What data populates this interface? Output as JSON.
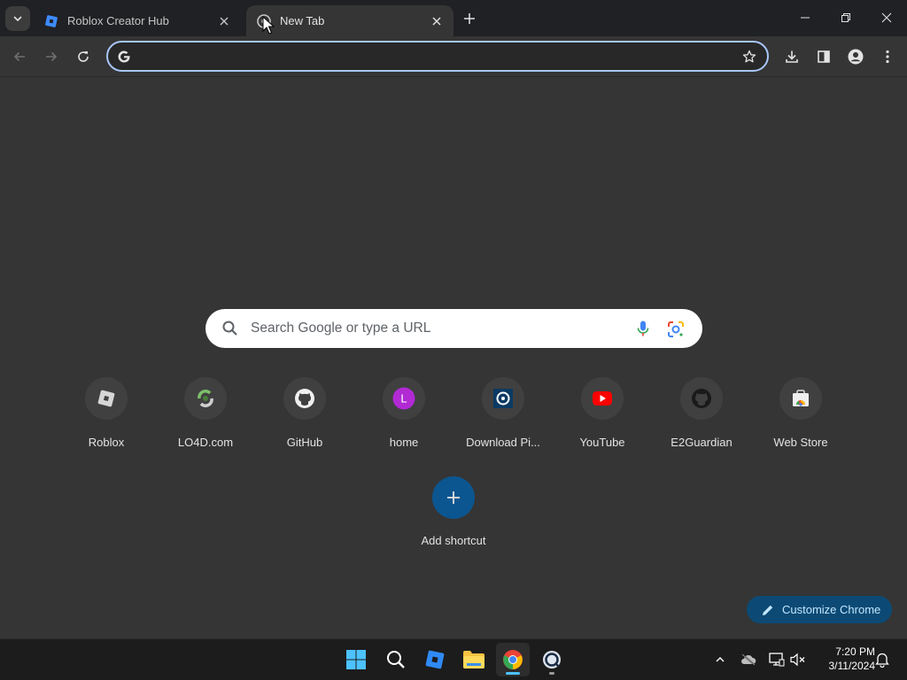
{
  "tabs": [
    {
      "title": "Roblox Creator Hub",
      "favicon": "roblox-studio-icon"
    },
    {
      "title": "New Tab",
      "favicon": "chrome-newtab-icon"
    }
  ],
  "omnibox": {
    "value": "",
    "placeholder": ""
  },
  "ntp": {
    "search_placeholder": "Search Google or type a URL",
    "shortcuts": [
      {
        "label": "Roblox",
        "icon": "roblox-icon"
      },
      {
        "label": "LO4D.com",
        "icon": "lo4d-icon"
      },
      {
        "label": "GitHub",
        "icon": "github-icon"
      },
      {
        "label": "home",
        "icon": "letter-l-icon",
        "letter": "L"
      },
      {
        "label": "Download Pi...",
        "icon": "pi-download-icon"
      },
      {
        "label": "YouTube",
        "icon": "youtube-icon"
      },
      {
        "label": "E2Guardian",
        "icon": "github-icon"
      },
      {
        "label": "Web Store",
        "icon": "web-store-icon"
      }
    ],
    "add_shortcut": "Add shortcut",
    "customize": "Customize Chrome"
  },
  "taskbar": {
    "time": "7:20 PM",
    "date": "3/11/2024"
  },
  "colors": {
    "accent": "#a8c7fa",
    "page_bg": "#353535",
    "tabstrip_bg": "#202124",
    "customize_bg": "#0c4a75",
    "add_shortcut_bg": "#0b5690"
  }
}
